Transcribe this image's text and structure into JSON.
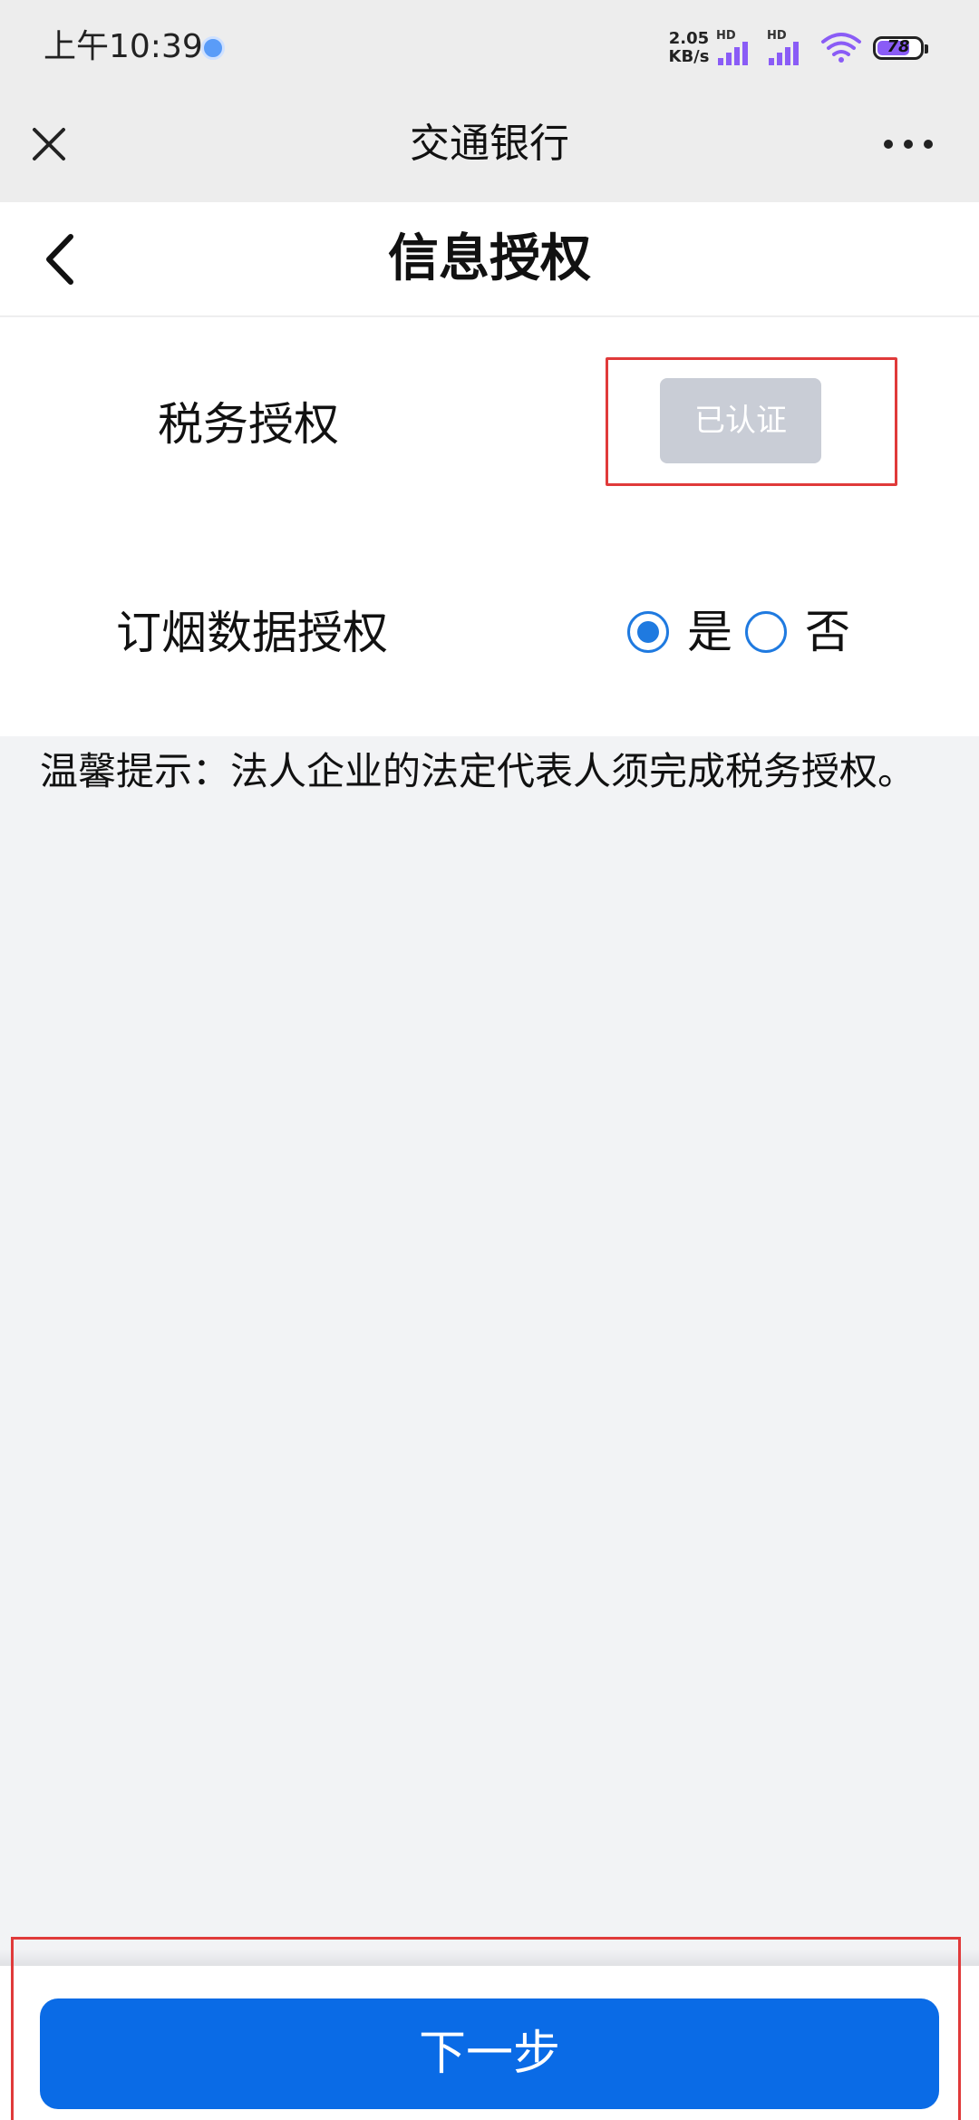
{
  "status_bar": {
    "time": "上午10:39",
    "net_speed_value": "2.05",
    "net_speed_unit": "KB/s",
    "signal_1_label": "HD",
    "signal_2_label": "HD",
    "battery_level": "78"
  },
  "app_bar": {
    "title": "交通银行"
  },
  "page": {
    "title": "信息授权"
  },
  "form": {
    "tax_auth_label": "税务授权",
    "tax_auth_status": "已认证",
    "tobacco_auth_label": "订烟数据授权",
    "yes_label": "是",
    "no_label": "否",
    "selected_option": "是"
  },
  "tip": {
    "text": "温馨提示：法人企业的法定代表人须完成税务授权。"
  },
  "footer": {
    "next_label": "下一步"
  },
  "colors": {
    "accent": "#0a6be6",
    "radio": "#1f7ae0",
    "disabled_button": "#c9cdd6",
    "highlight": "#e03a3a",
    "background": "#f2f3f5"
  }
}
